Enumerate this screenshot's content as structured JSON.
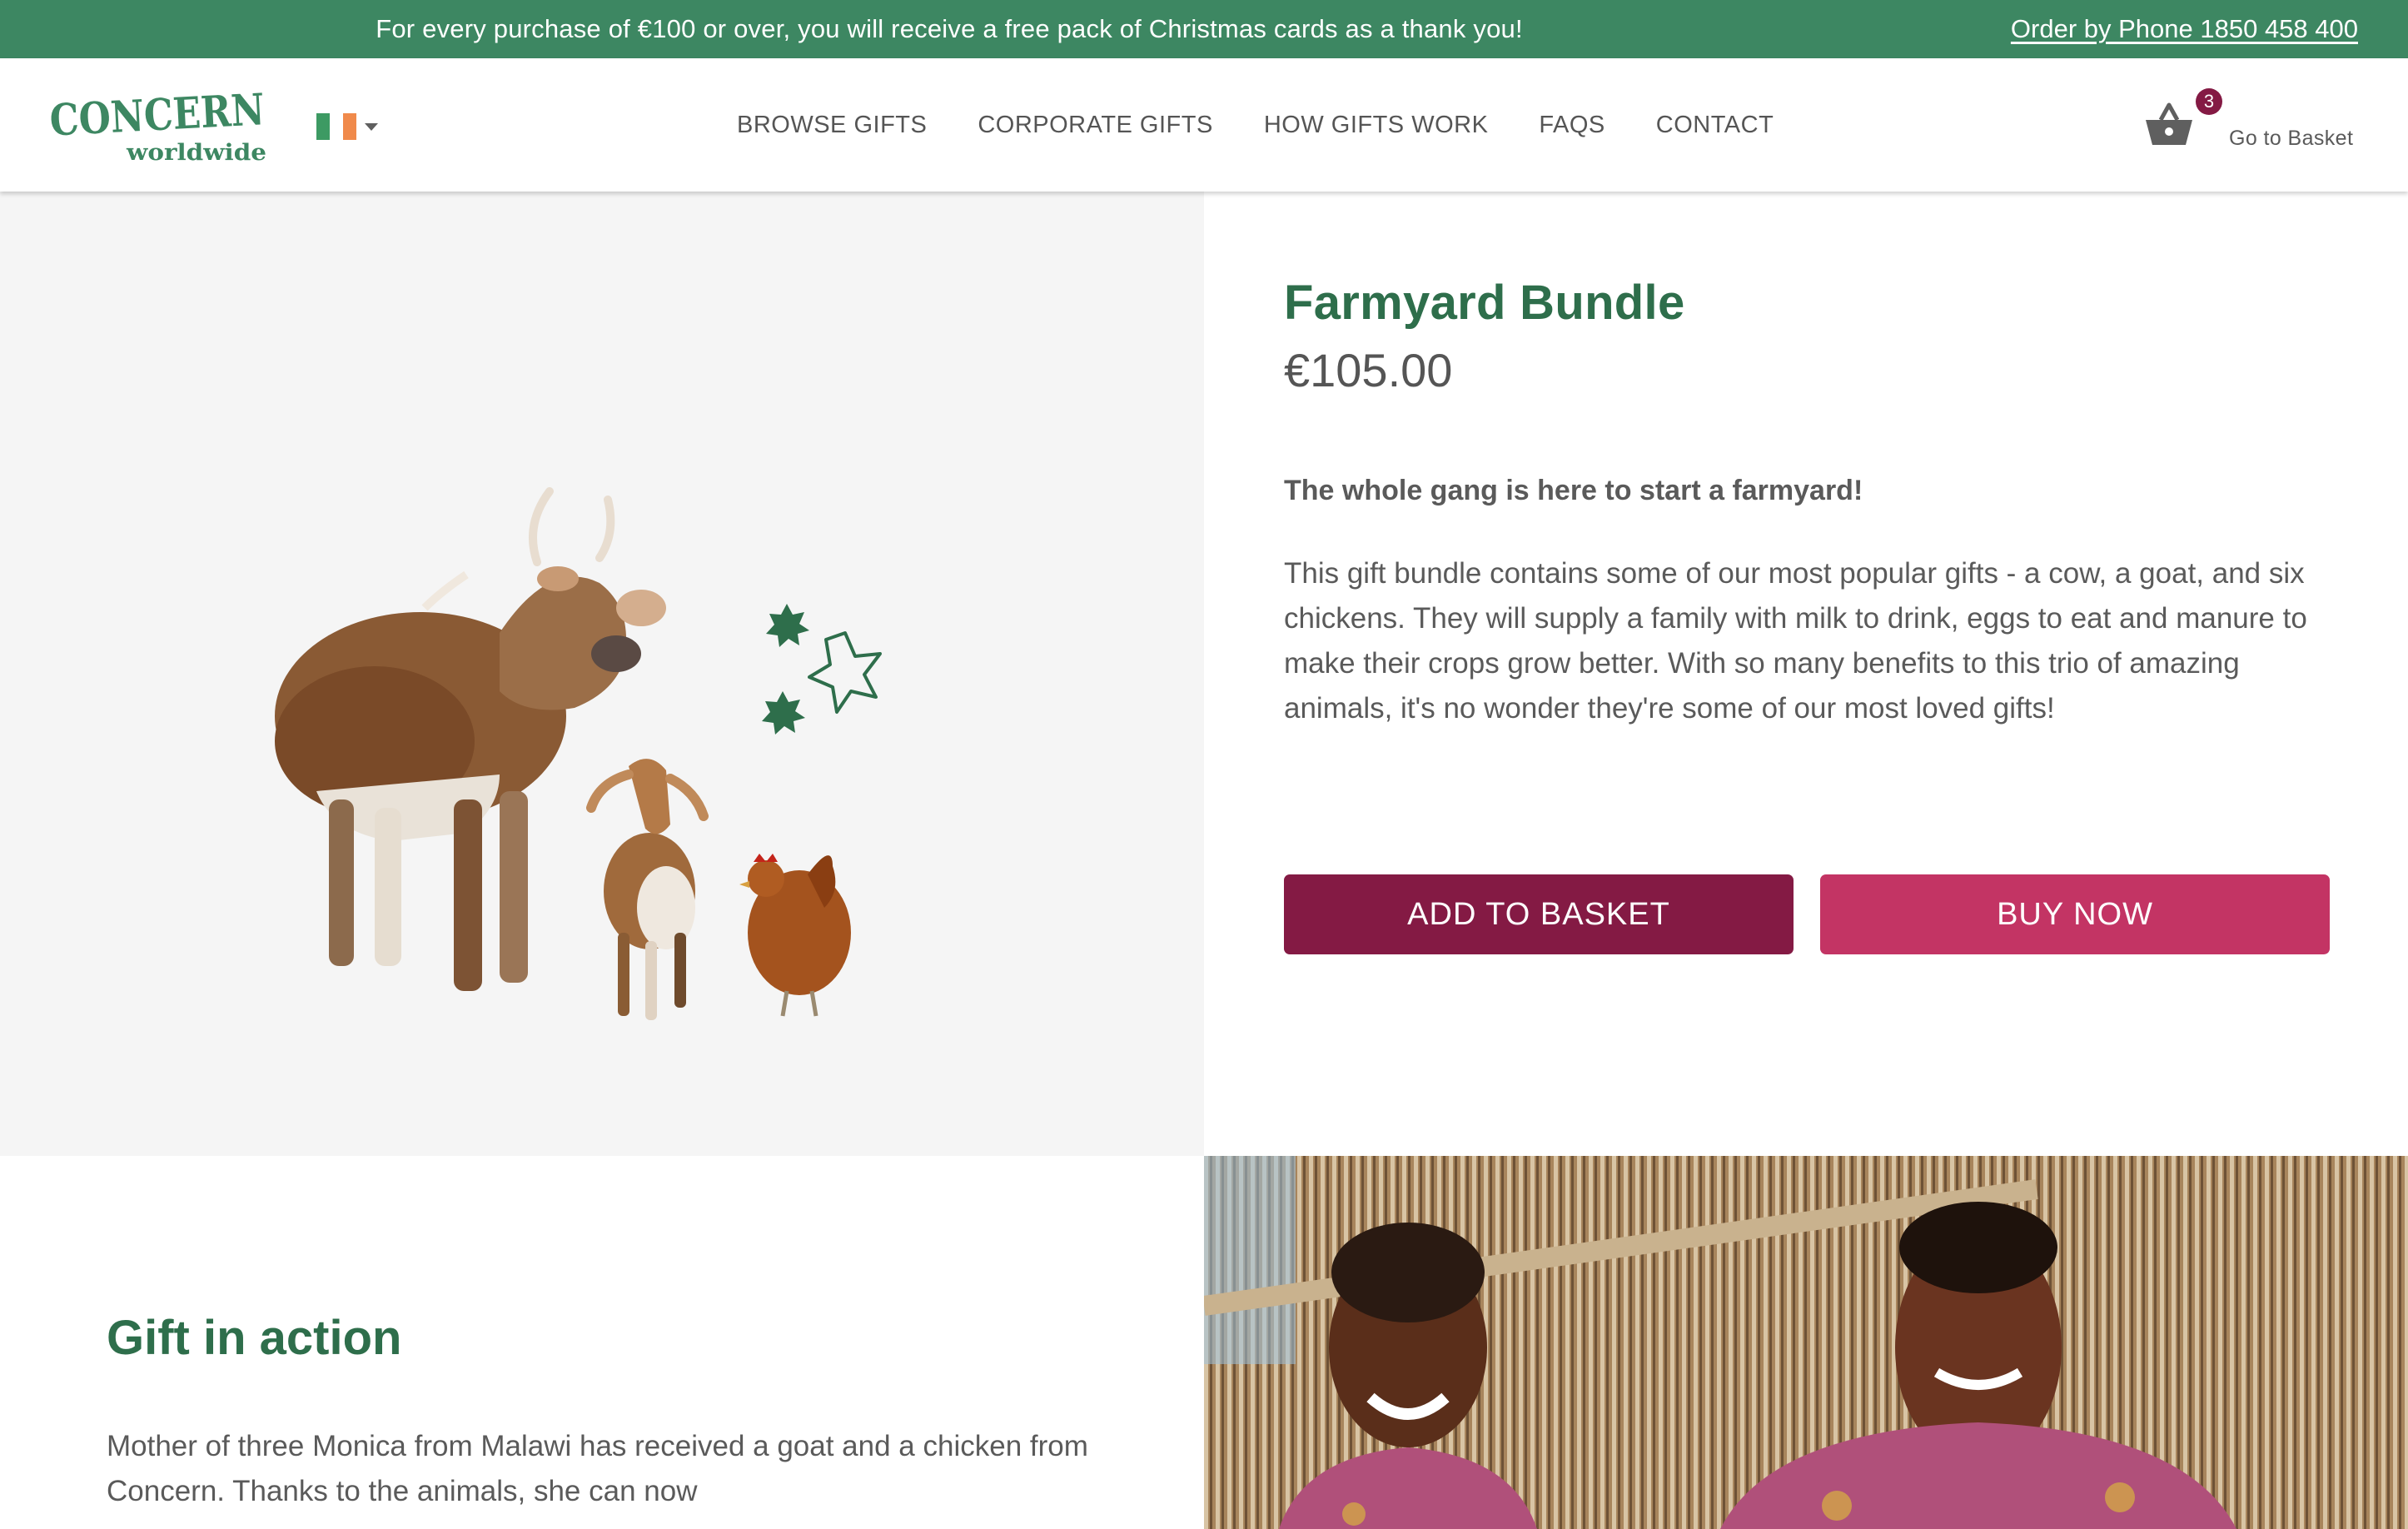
{
  "promo_bar": {
    "message": "For every purchase of €100 or over, you will receive a free pack of Christmas cards as a thank you!",
    "phone_link": "Order by Phone 1850 458 400"
  },
  "header": {
    "logo": {
      "line1": "CONCERN",
      "line2": "worldwide"
    },
    "country_selector": {
      "flag": "ireland-flag-icon",
      "icon": "chevron-down-icon"
    },
    "nav": [
      {
        "label": "BROWSE GIFTS"
      },
      {
        "label": "CORPORATE GIFTS"
      },
      {
        "label": "HOW GIFTS WORK"
      },
      {
        "label": "FAQS"
      },
      {
        "label": "CONTACT"
      }
    ],
    "basket": {
      "count": "3",
      "label": "Go to Basket",
      "icon": "basket-icon"
    }
  },
  "product": {
    "image_alt": "A cow, a goat and a chicken with green stars",
    "title": "Farmyard Bundle",
    "price": "€105.00",
    "tagline": "The whole gang is here to start a farmyard!",
    "description": "This gift bundle contains some of our most popular gifts - a cow, a goat, and six chickens. They will supply a family with milk to drink, eggs to eat and manure to make their crops grow better. With so many benefits to this trio of amazing animals, it's no wonder they're some of our most loved gifts!",
    "add_to_basket_label": "ADD TO BASKET",
    "buy_now_label": "BUY NOW"
  },
  "gift_in_action": {
    "title": "Gift in action",
    "text": "Mother of three Monica from Malawi has received a goat and a chicken from Concern. Thanks to the animals, she can now",
    "photo_alt": "Smiling girl and mother in front of a reed fence"
  },
  "colors": {
    "brand_green": "#3d8762",
    "heading_green": "#2e6e4b",
    "primary_button": "#841a44",
    "secondary_button": "#c33464",
    "badge": "#841a44"
  }
}
